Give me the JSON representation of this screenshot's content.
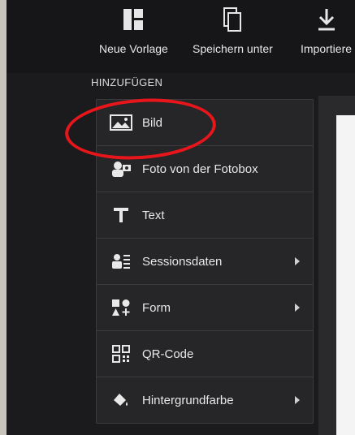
{
  "toolbar": {
    "new_template": {
      "label": "Neue Vorlage",
      "icon": "template-icon"
    },
    "save_as": {
      "label": "Speichern unter",
      "icon": "copy-icon"
    },
    "import": {
      "label": "Importiere",
      "icon": "download-icon"
    }
  },
  "add_section": {
    "title": "HINZUFÜGEN",
    "items": [
      {
        "label": "Bild",
        "icon": "image-icon",
        "submenu": false
      },
      {
        "label": "Foto von der Fotobox",
        "icon": "photobooth-icon",
        "submenu": false
      },
      {
        "label": "Text",
        "icon": "text-icon",
        "submenu": false
      },
      {
        "label": "Sessionsdaten",
        "icon": "session-data-icon",
        "submenu": true
      },
      {
        "label": "Form",
        "icon": "shape-icon",
        "submenu": true
      },
      {
        "label": "QR-Code",
        "icon": "qr-code-icon",
        "submenu": false
      },
      {
        "label": "Hintergrundfarbe",
        "icon": "paint-bucket-icon",
        "submenu": true
      }
    ]
  },
  "colors": {
    "background": "#1b1b1d",
    "panel": "#262628",
    "text": "#e8e8e8",
    "highlight": "#e8161b"
  }
}
